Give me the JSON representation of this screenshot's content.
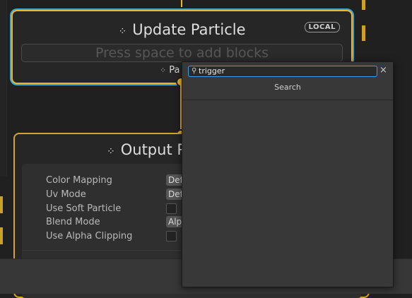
{
  "update_node": {
    "title": "Update Particle",
    "badge": "LOCAL",
    "placeholder": "Press space to add blocks",
    "sub_label": "Pa"
  },
  "output_node": {
    "title": "Output Pa",
    "properties": [
      {
        "label": "Color Mapping",
        "kind": "dropdown",
        "value": "Def"
      },
      {
        "label": "Uv Mode",
        "kind": "dropdown",
        "value": "Def"
      },
      {
        "label": "Use Soft Particle",
        "kind": "checkbox",
        "checked": false
      },
      {
        "label": "Blend Mode",
        "kind": "dropdown",
        "value": "Alp"
      },
      {
        "label": "Use Alpha Clipping",
        "kind": "checkbox",
        "checked": false
      }
    ]
  },
  "search_popup": {
    "query": "trigger",
    "header": "Search",
    "clear_glyph": "×",
    "search_glyph": "🔍"
  },
  "icons": {
    "context_icon": "▾",
    "accent_color": "#f0b429",
    "selection_color": "#3aa6e0"
  }
}
